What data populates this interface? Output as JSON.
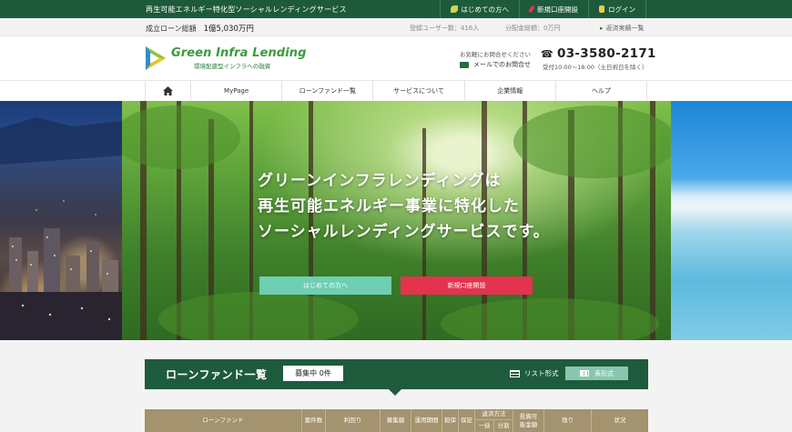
{
  "topbar": {
    "tagline": "再生可能エネルギー特化型ソーシャルレンディングサービス",
    "links": [
      {
        "label": "はじめての方へ",
        "icon": "leaf-icon",
        "color": "#c9d94a"
      },
      {
        "label": "新規口座開設",
        "icon": "pen-icon",
        "color": "#e3334e"
      },
      {
        "label": "ログイン",
        "icon": "door-icon",
        "color": "#f2c94c"
      }
    ]
  },
  "stats": {
    "loan_label": "成立ローン総額",
    "loan_value": "1億5,030万円",
    "users": "登録ユーザー数：416人",
    "distributed": "分配金総額：0万円",
    "repayment_link": "返済実績一覧"
  },
  "header": {
    "brand": "Green Infra Lending",
    "brand_sub": "環境配慮型インフラへの融資",
    "contact_note": "お気軽にお問合せください",
    "mail_label": "メールでのお問合せ",
    "phone": "03-3580-2171",
    "hours": "受付10:00〜18:00（土日祝日を除く）"
  },
  "nav": {
    "items": [
      "MyPage",
      "ローンファンド一覧",
      "サービスについて",
      "企業情報",
      "ヘルプ"
    ]
  },
  "hero": {
    "lines": [
      "グリーンインフラレンディングは",
      "再生可能エネルギー事業に特化した",
      "ソーシャルレンディングサービスです。"
    ],
    "btn_begin": "はじめての方へ",
    "btn_open": "新規口座開設"
  },
  "fund": {
    "title": "ローンファンド一覧",
    "badge": "募集中 0件",
    "list_view": "リスト形式",
    "table_view": "表形式",
    "columns": {
      "fund": "ローンファンド",
      "count": "案件数",
      "yield": "利回り",
      "amount": "募集額",
      "period": "運用期間",
      "collateral": "担保",
      "guarantee": "保証",
      "repay": "返済方法",
      "repay_lump": "一括",
      "repay_split": "分割",
      "invest": "投資可能金額",
      "remain": "残り",
      "status": "状況"
    }
  }
}
